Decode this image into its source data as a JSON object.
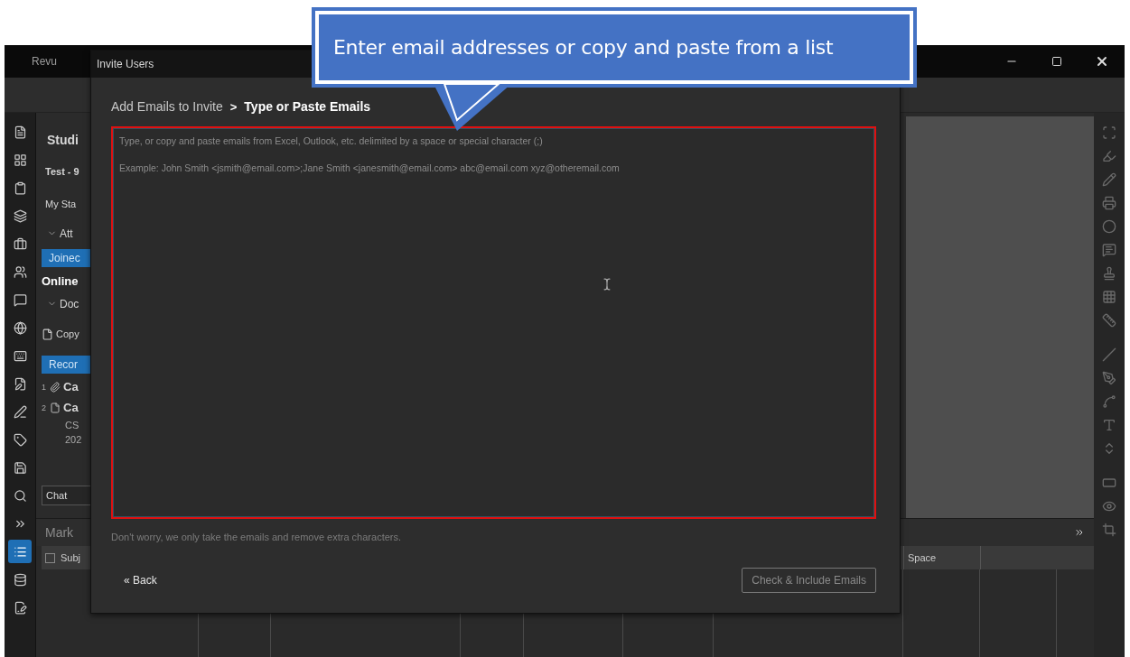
{
  "app": {
    "title": "Revu"
  },
  "left_toolbar": [
    {
      "selected": false
    },
    {
      "selected": false
    },
    {
      "selected": false
    },
    {
      "selected": false
    },
    {
      "selected": false
    },
    {
      "selected": false
    },
    {
      "selected": false
    },
    {
      "selected": false
    },
    {
      "selected": false
    },
    {
      "selected": false
    },
    {
      "selected": false
    },
    {
      "selected": false
    },
    {
      "selected": false
    },
    {
      "selected": false
    },
    {
      "selected": false
    },
    {
      "selected": true
    },
    {
      "selected": false
    },
    {
      "selected": false
    }
  ],
  "left_panel": {
    "items": [
      {
        "kind": "title",
        "text": "Studi"
      },
      {
        "kind": "bold",
        "text": "Test - 9"
      },
      {
        "kind": "text",
        "text": "My Sta"
      },
      {
        "kind": "section",
        "text": "Att"
      },
      {
        "kind": "highlight",
        "text": "Joinec"
      },
      {
        "kind": "heading",
        "text": "Online"
      },
      {
        "kind": "section",
        "text": "Doc"
      },
      {
        "kind": "file",
        "text": "Copy"
      },
      {
        "kind": "highlight",
        "text": "Recor"
      },
      {
        "kind": "attachment-record",
        "number": "1",
        "text": "Ca"
      },
      {
        "kind": "file-record",
        "number": "2",
        "text": "Ca"
      },
      {
        "kind": "sub",
        "text": "CS"
      },
      {
        "kind": "sub",
        "text": "202"
      }
    ],
    "chat_field": {
      "value": "Chat"
    }
  },
  "markups": {
    "title": "Mark",
    "select_all": {
      "checked": false
    },
    "columns": [
      "Subj",
      "Space"
    ]
  },
  "dialog": {
    "title": "Invite Users",
    "breadcrumb": [
      {
        "label": "Add Emails to Invite",
        "selected": false
      },
      {
        "label": "Type or Paste Emails",
        "selected": true
      }
    ],
    "separator": ">",
    "placeholder": "Type, or copy and paste emails from Excel, Outlook, etc. delimited by a space or special character (;)\n\nExample: John Smith <jsmith@email.com>;Jane Smith <janesmith@email.com> abc@email.com xyz@otheremail.com",
    "hint": "Don't worry, we only take the emails and remove extra characters.",
    "back_button": "« Back",
    "primary_button": {
      "label": "Check & Include Emails",
      "disabled": true
    }
  },
  "callout": {
    "text": "Enter email addresses or copy and paste from a list"
  }
}
